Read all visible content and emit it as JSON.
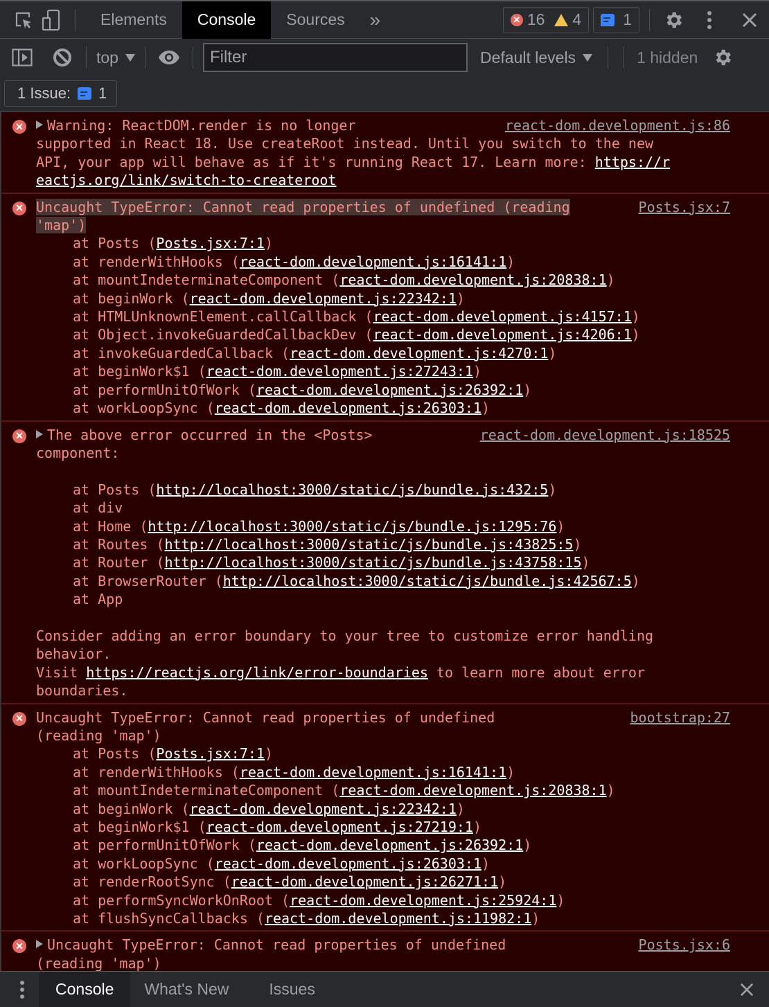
{
  "topbar": {
    "tabs": [
      "Elements",
      "Console",
      "Sources"
    ],
    "active_tab": "Console",
    "more_tabs": "»",
    "error_count": "16",
    "warning_count": "4",
    "issue_count": "1",
    "icons": [
      "inspect-element-icon",
      "device-toolbar-icon",
      "settings-icon",
      "more-vert-icon",
      "close-icon"
    ]
  },
  "toolbar": {
    "context": "top",
    "filter_placeholder": "Filter",
    "levels": "Default levels",
    "hidden": "1 hidden"
  },
  "issues_bar": {
    "label": "1 Issue:",
    "count": "1"
  },
  "messages": [
    {
      "type": "error",
      "expandable": true,
      "source": "react-dom.development.js:86",
      "lines": [
        "Warning: ReactDOM.render is no longer",
        "supported in React 18. Use createRoot instead. Until you switch to the new",
        "API, your app will behave as if it's running React 17. Learn more: "
      ],
      "link_part1": "https://r",
      "link_part2": "eactjs.org/link/switch-to-createroot"
    },
    {
      "type": "error",
      "expandable": false,
      "source": "Posts.jsx:7",
      "head1": "Uncaught TypeError: Cannot read properties of undefined (reading ",
      "head2": "'map')",
      "stack": [
        {
          "fn": "at Posts (",
          "loc": "Posts.jsx:7:1"
        },
        {
          "fn": "at renderWithHooks (",
          "loc": "react-dom.development.js:16141:1"
        },
        {
          "fn": "at mountIndeterminateComponent (",
          "loc": "react-dom.development.js:20838:1"
        },
        {
          "fn": "at beginWork (",
          "loc": "react-dom.development.js:22342:1"
        },
        {
          "fn": "at HTMLUnknownElement.callCallback (",
          "loc": "react-dom.development.js:4157:1"
        },
        {
          "fn": "at Object.invokeGuardedCallbackDev (",
          "loc": "react-dom.development.js:4206:1"
        },
        {
          "fn": "at invokeGuardedCallback (",
          "loc": "react-dom.development.js:4270:1"
        },
        {
          "fn": "at beginWork$1 (",
          "loc": "react-dom.development.js:27243:1"
        },
        {
          "fn": "at performUnitOfWork (",
          "loc": "react-dom.development.js:26392:1"
        },
        {
          "fn": "at workLoopSync (",
          "loc": "react-dom.development.js:26303:1"
        }
      ]
    },
    {
      "type": "error",
      "expandable": true,
      "source": "react-dom.development.js:18525",
      "head1": "The above error occurred in the <Posts>",
      "head2": "component:",
      "stack": [
        {
          "fn": "at Posts (",
          "loc": "http://localhost:3000/static/js/bundle.js:432:5"
        },
        {
          "fn": "at div",
          "loc": ""
        },
        {
          "fn": "at Home (",
          "loc": "http://localhost:3000/static/js/bundle.js:1295:76"
        },
        {
          "fn": "at Routes (",
          "loc": "http://localhost:3000/static/js/bundle.js:43825:5"
        },
        {
          "fn": "at Router (",
          "loc": "http://localhost:3000/static/js/bundle.js:43758:15"
        },
        {
          "fn": "at BrowserRouter (",
          "loc": "http://localhost:3000/static/js/bundle.js:42567:5"
        },
        {
          "fn": "at App",
          "loc": ""
        }
      ],
      "tail1": "Consider adding an error boundary to your tree to customize error handling",
      "tail2": "behavior.",
      "tail3_pre": "Visit ",
      "tail3_link": "https://reactjs.org/link/error-boundaries",
      "tail3_post": " to learn more about error",
      "tail4": "boundaries."
    },
    {
      "type": "error",
      "expandable": false,
      "source": "bootstrap:27",
      "head1": "Uncaught TypeError: Cannot read properties of undefined",
      "head2": "(reading 'map')",
      "stack": [
        {
          "fn": "at Posts (",
          "loc": "Posts.jsx:7:1"
        },
        {
          "fn": "at renderWithHooks (",
          "loc": "react-dom.development.js:16141:1"
        },
        {
          "fn": "at mountIndeterminateComponent (",
          "loc": "react-dom.development.js:20838:1"
        },
        {
          "fn": "at beginWork (",
          "loc": "react-dom.development.js:22342:1"
        },
        {
          "fn": "at beginWork$1 (",
          "loc": "react-dom.development.js:27219:1"
        },
        {
          "fn": "at performUnitOfWork (",
          "loc": "react-dom.development.js:26392:1"
        },
        {
          "fn": "at workLoopSync (",
          "loc": "react-dom.development.js:26303:1"
        },
        {
          "fn": "at renderRootSync (",
          "loc": "react-dom.development.js:26271:1"
        },
        {
          "fn": "at performSyncWorkOnRoot (",
          "loc": "react-dom.development.js:25924:1"
        },
        {
          "fn": "at flushSyncCallbacks (",
          "loc": "react-dom.development.js:11982:1"
        }
      ]
    },
    {
      "type": "error",
      "expandable": true,
      "source": "Posts.jsx:6",
      "head1": "Uncaught TypeError: Cannot read properties of undefined",
      "head2": "(reading 'map')"
    }
  ],
  "drawer": {
    "tabs": [
      "Console",
      "What's New",
      "Issues"
    ],
    "active_tab": "Console"
  },
  "colors": {
    "error_bg": "#290000",
    "error_text": "#f28b82",
    "error_icon": "#e46962",
    "warning_icon": "#f2c14e",
    "issue_icon": "#3b82f6",
    "panel_bg": "#292a2d"
  }
}
